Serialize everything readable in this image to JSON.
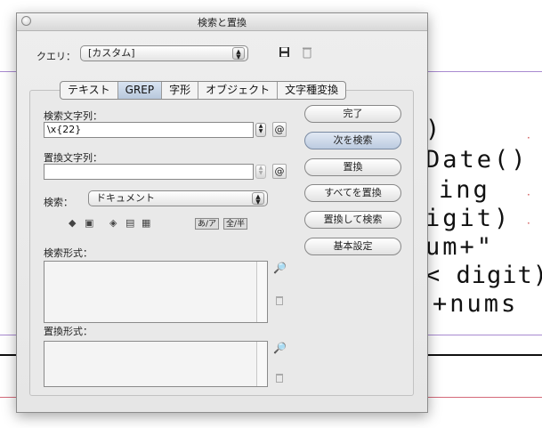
{
  "background_doc": {
    "lines": [
      ") ",
      "Date()",
      "ing",
      "igit)",
      "um+\"",
      "< digit)",
      "+nums"
    ]
  },
  "dialog": {
    "title": "検索と置換",
    "query_label": "クエリ：",
    "query_value": "[カスタム]",
    "tabs": [
      {
        "label": "テキスト",
        "active": false
      },
      {
        "label": "GREP",
        "active": true
      },
      {
        "label": "字形",
        "active": false
      },
      {
        "label": "オブジェクト",
        "active": false
      },
      {
        "label": "文字種変換",
        "active": false
      }
    ],
    "find_label": "検索文字列：",
    "find_value": "\\x{22}",
    "change_label": "置換文字列：",
    "change_value": "",
    "search_label": "検索：",
    "search_value": "ドキュメント",
    "find_format_label": "検索形式：",
    "change_format_label": "置換形式：",
    "toggle_kana": "あ/ア",
    "toggle_width": "全/半",
    "buttons": {
      "done": "完了",
      "find_next": "次を検索",
      "change": "置換",
      "change_all": "すべてを置換",
      "change_find": "置換して検索",
      "fewer_options": "基本設定"
    }
  }
}
